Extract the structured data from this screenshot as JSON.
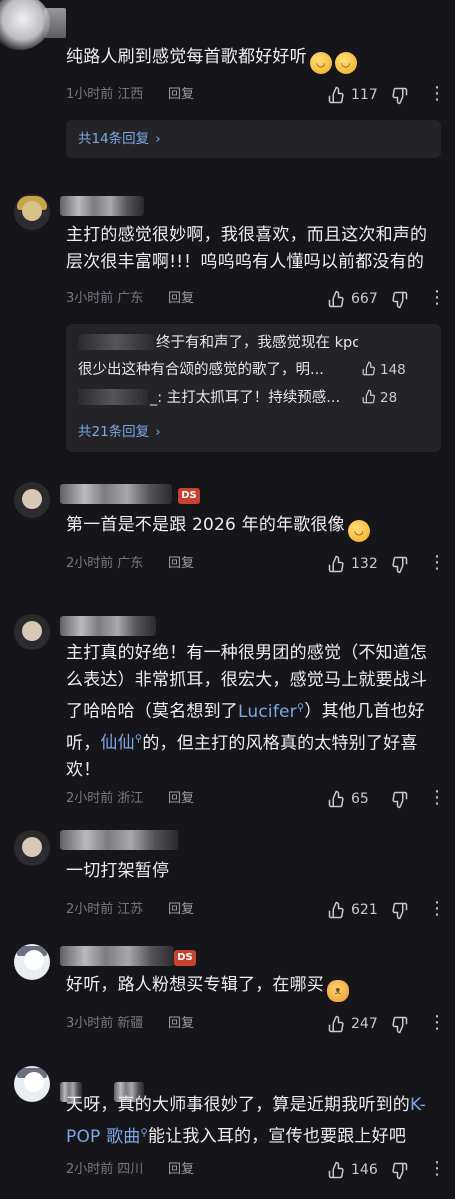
{
  "comments": [
    {
      "text_parts": [
        "纯路人刷到感觉每首歌都好好听"
      ],
      "emojis": [
        "face-blush-emoji",
        "face-blush-emoji"
      ],
      "time": "1小时前",
      "location": "江西",
      "reply_label": "回复",
      "likes": "117",
      "replies_total": "共14条回复",
      "avatar_style": "light"
    },
    {
      "text_parts": [
        "主打的感觉很妙啊，我很喜欢，而且这次和声的层次很丰富啊!!！呜呜呜有人懂吗以前都没有的"
      ],
      "time": "3小时前",
      "location": "广东",
      "reply_label": "回复",
      "likes": "667",
      "badge": "",
      "sub_replies": [
        {
          "text": "终于有和声了，我感觉现在 kpop 都",
          "likes": ""
        },
        {
          "text": "很少出这种有合颂的感觉的歌了，明...",
          "likes": "148"
        },
        {
          "text": "_: 主打太抓耳了！持续预感...",
          "likes": "28"
        }
      ],
      "replies_total": "共21条回复"
    },
    {
      "text": "第一首是不是跟 2026 年的年歌很像",
      "time": "2小时前",
      "location": "广东",
      "reply_label": "回复",
      "likes": "132"
    },
    {
      "text_a": "主打真的好绝！有一种很男团的感觉（不知道怎么表达）非常抓耳，很宏大，感觉马上就要战斗了哈哈哈（莫名想到了",
      "link1": "Lucifer",
      "text_b": "）其他几首也好听，",
      "link2": "仙仙",
      "text_c": "的，但主打的风格真的太特别了好喜欢！",
      "time": "2小时前",
      "location": "浙江",
      "reply_label": "回复",
      "likes": "65"
    },
    {
      "text": "一切打架暂停",
      "time": "2小时前",
      "location": "江苏",
      "reply_label": "回复",
      "likes": "621"
    },
    {
      "text": "好听，路人粉想买专辑了，在哪买",
      "time": "3小时前",
      "location": "新疆",
      "reply_label": "回复",
      "likes": "247"
    },
    {
      "text_a": "天呀，真的大师事很妙了，算是近期我听到的",
      "link1": "K-POP 歌曲",
      "text_b": "能让我入耳的，宣传也要跟上好吧",
      "time": "2小时前",
      "location": "四川",
      "reply_label": "回复",
      "likes": "146"
    }
  ],
  "badge_text": "DS",
  "colors": {
    "background": "#16161a",
    "link": "#7aa7e6",
    "badge": "#c7432f"
  },
  "icons": {
    "like": "thumb-up-icon",
    "dislike": "thumb-down-icon",
    "more": "more-vertical-icon",
    "chevron": "chevron-right-icon",
    "search": "search-icon"
  }
}
